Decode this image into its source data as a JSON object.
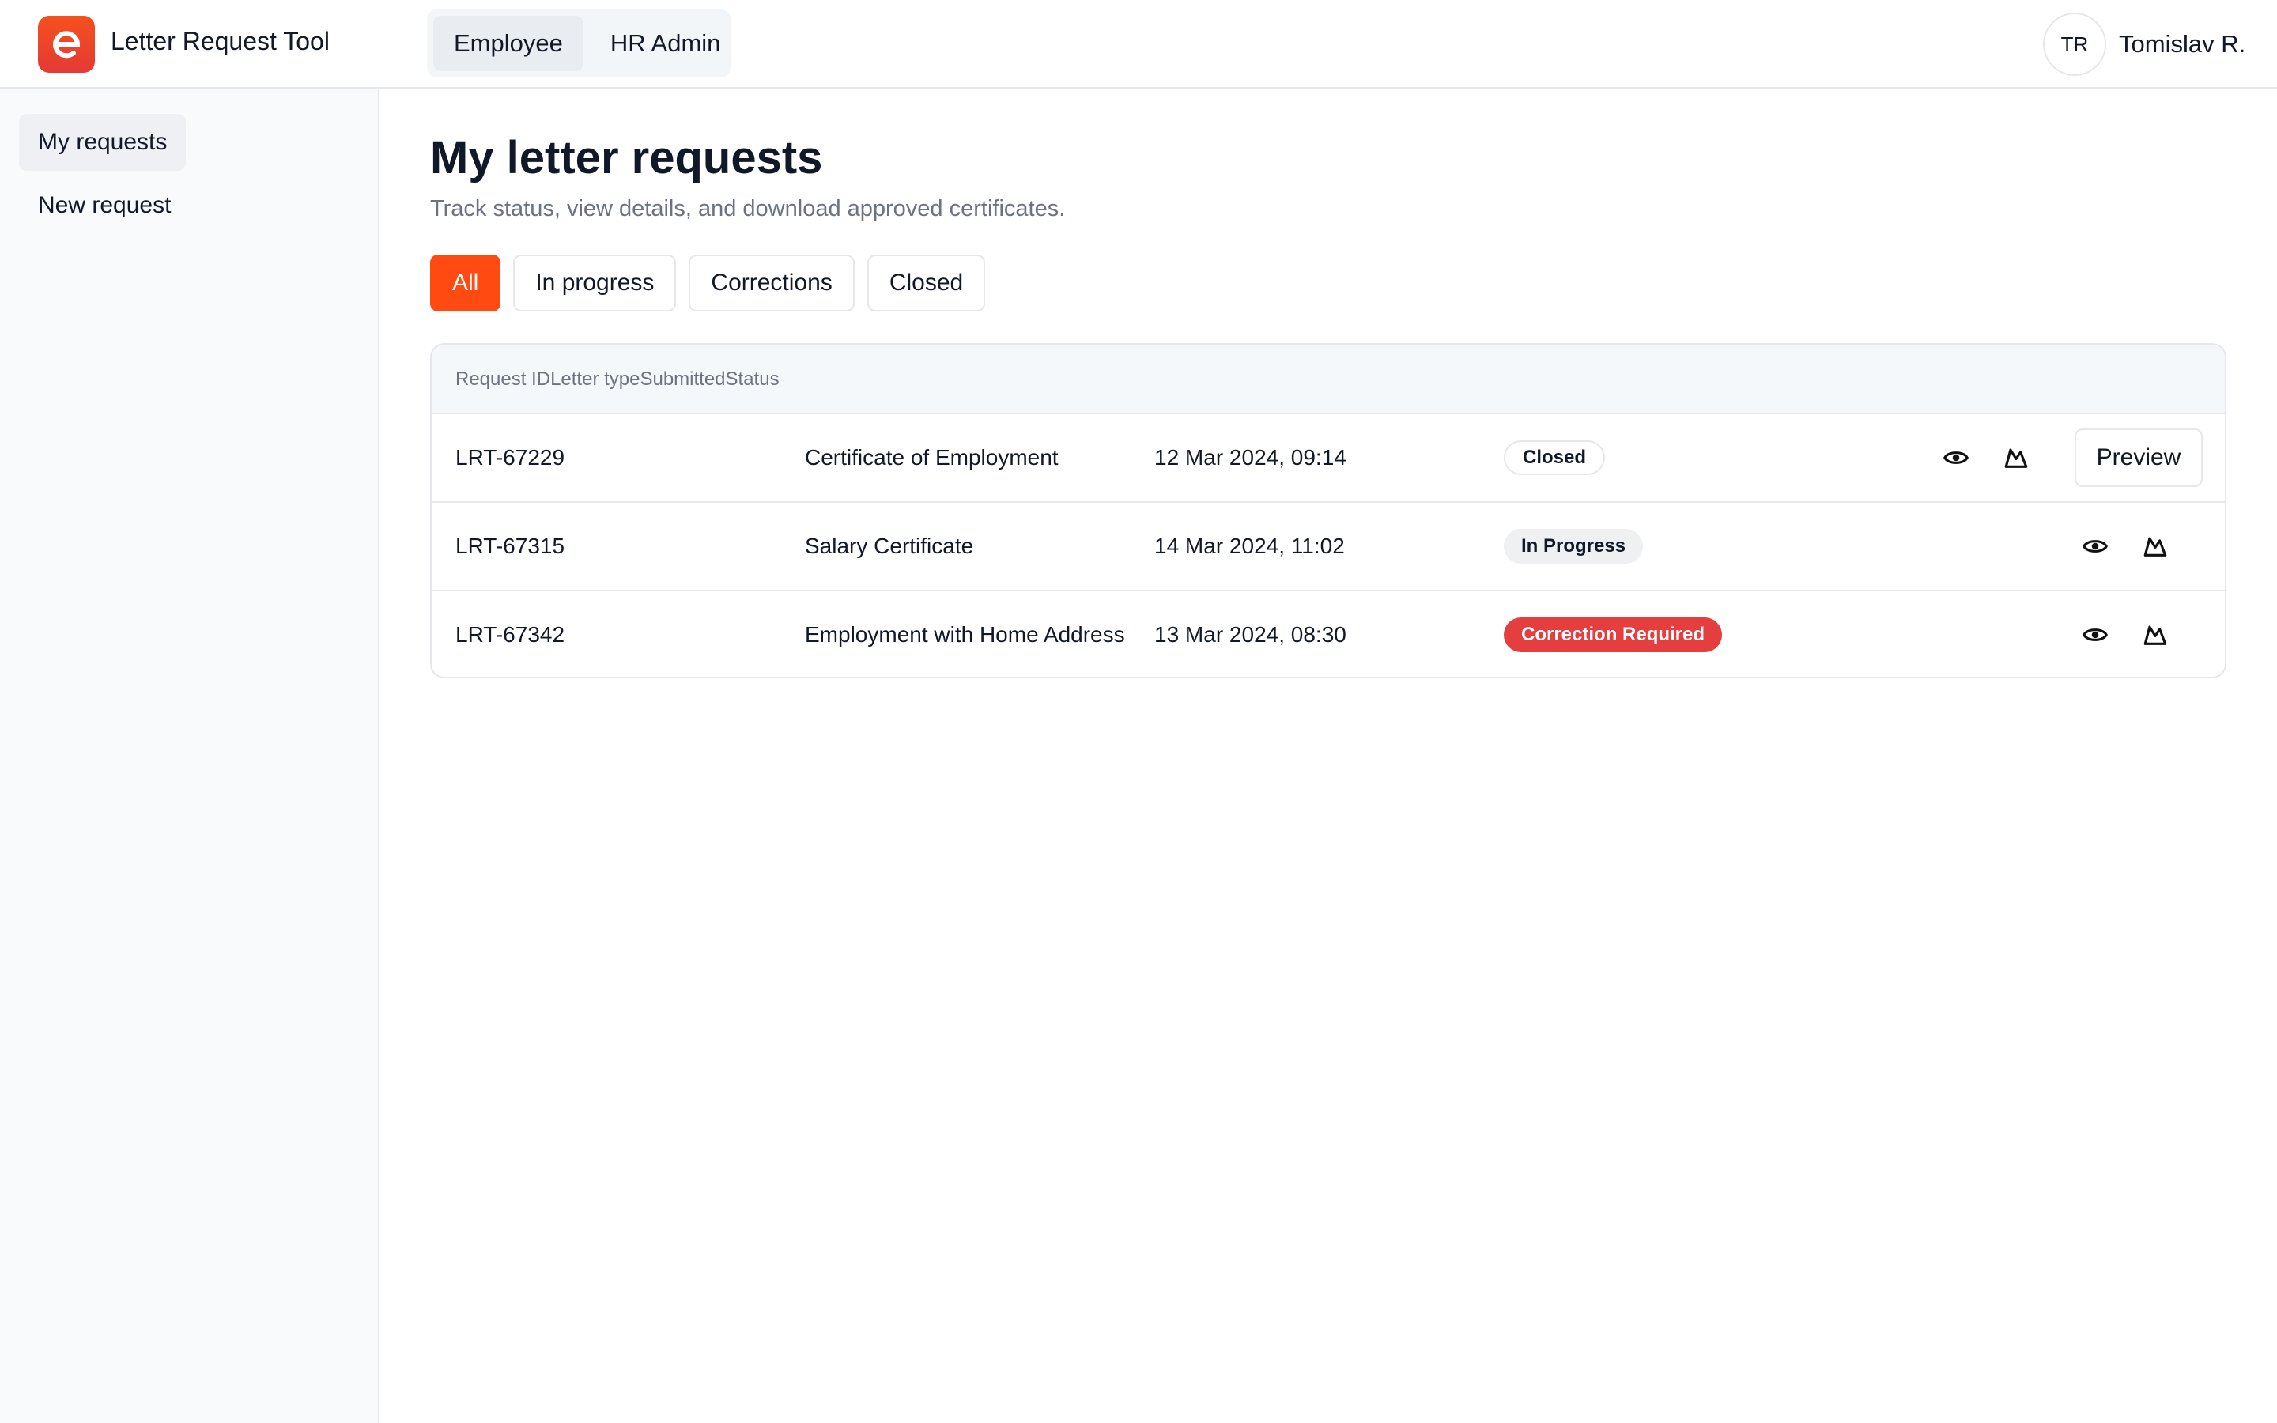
{
  "app": {
    "title": "Letter Request Tool",
    "accent_color": "#ff4a12"
  },
  "header": {
    "roles": [
      {
        "label": "Employee",
        "active": true
      },
      {
        "label": "HR Admin",
        "active": false
      }
    ],
    "user": {
      "initials": "TR",
      "name": "Tomislav R."
    }
  },
  "sidebar": {
    "items": [
      {
        "label": "My requests",
        "active": true
      },
      {
        "label": "New request",
        "active": false
      }
    ]
  },
  "main": {
    "title": "My letter requests",
    "subtitle": "Track status, view details, and download approved certificates.",
    "filters": [
      {
        "label": "All",
        "active": true
      },
      {
        "label": "In progress",
        "active": false
      },
      {
        "label": "Corrections",
        "active": false
      },
      {
        "label": "Closed",
        "active": false
      }
    ],
    "table": {
      "headers": [
        "Request ID",
        "Letter type",
        "Submitted",
        "Status"
      ],
      "rows": [
        {
          "id": "LRT-67229",
          "type": "Certificate of Employment",
          "submitted": "12 Mar 2024, 09:14",
          "status": "Closed",
          "status_color": "#ffffff",
          "preview_label": "Preview"
        },
        {
          "id": "LRT-67315",
          "type": "Salary Certificate",
          "submitted": "14 Mar 2024, 11:02",
          "status": "In Progress",
          "status_color": "#eef0f2"
        },
        {
          "id": "LRT-67342",
          "type": "Employment with Home Address",
          "submitted": "13 Mar 2024, 08:30",
          "status": "Correction Required",
          "status_color": "#e53e3e"
        }
      ],
      "action_icons": [
        "eye-icon",
        "mountain-icon"
      ]
    }
  }
}
